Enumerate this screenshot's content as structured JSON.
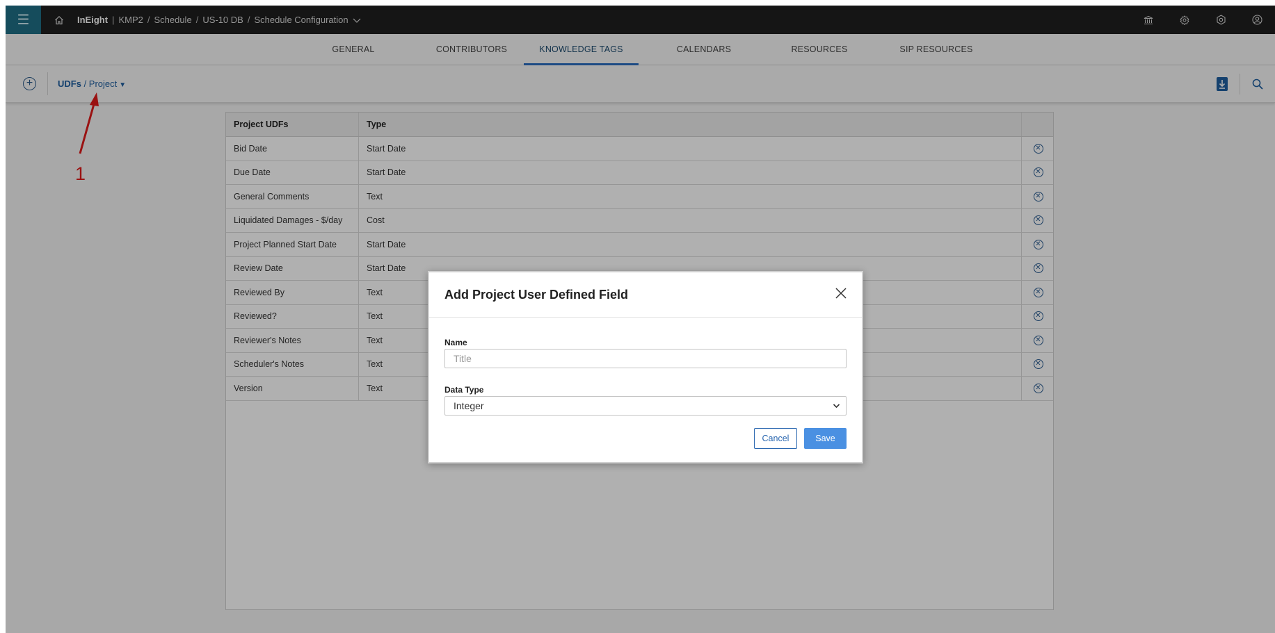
{
  "topbar": {
    "brand": "InEight",
    "crumbs": [
      "KMP2",
      "Schedule",
      "US-10 DB",
      "Schedule Configuration"
    ],
    "icons": [
      "menu-icon",
      "home-icon",
      "bank-icon",
      "settings-icon",
      "hexagon-settings-icon",
      "user-icon"
    ]
  },
  "tabs": [
    {
      "label": "GENERAL",
      "active": false
    },
    {
      "label": "CONTRIBUTORS",
      "active": false
    },
    {
      "label": "KNOWLEDGE TAGS",
      "active": true
    },
    {
      "label": "CALENDARS",
      "active": false
    },
    {
      "label": "RESOURCES",
      "active": false
    },
    {
      "label": "SIP RESOURCES",
      "active": false
    }
  ],
  "toolbar": {
    "path_root": "UDFs",
    "path_sep": " / ",
    "path_leaf": "Project",
    "caret": "▼"
  },
  "table": {
    "headers": [
      "Project UDFs",
      "Type"
    ],
    "rows": [
      {
        "name": "Bid Date",
        "type": "Start Date"
      },
      {
        "name": "Due Date",
        "type": "Start Date"
      },
      {
        "name": "General Comments",
        "type": "Text"
      },
      {
        "name": "Liquidated Damages - $/day",
        "type": "Cost"
      },
      {
        "name": "Project Planned Start Date",
        "type": "Start Date"
      },
      {
        "name": "Review Date",
        "type": "Start Date"
      },
      {
        "name": "Reviewed By",
        "type": "Text"
      },
      {
        "name": "Reviewed?",
        "type": "Text"
      },
      {
        "name": "Reviewer's Notes",
        "type": "Text"
      },
      {
        "name": "Scheduler's Notes",
        "type": "Text"
      },
      {
        "name": "Version",
        "type": "Text"
      }
    ]
  },
  "dialog": {
    "title": "Add Project User Defined Field",
    "name_label": "Name",
    "name_placeholder": "Title",
    "datatype_label": "Data Type",
    "datatype_value": "Integer",
    "cancel_label": "Cancel",
    "save_label": "Save"
  },
  "annotation": {
    "number": "1",
    "color": "#e01b1b"
  },
  "colors": {
    "accent": "#2a6dbf",
    "save_button": "#4a90e2",
    "topbar": "#1f1f1f",
    "hamburger_bg": "#1f6f86"
  }
}
